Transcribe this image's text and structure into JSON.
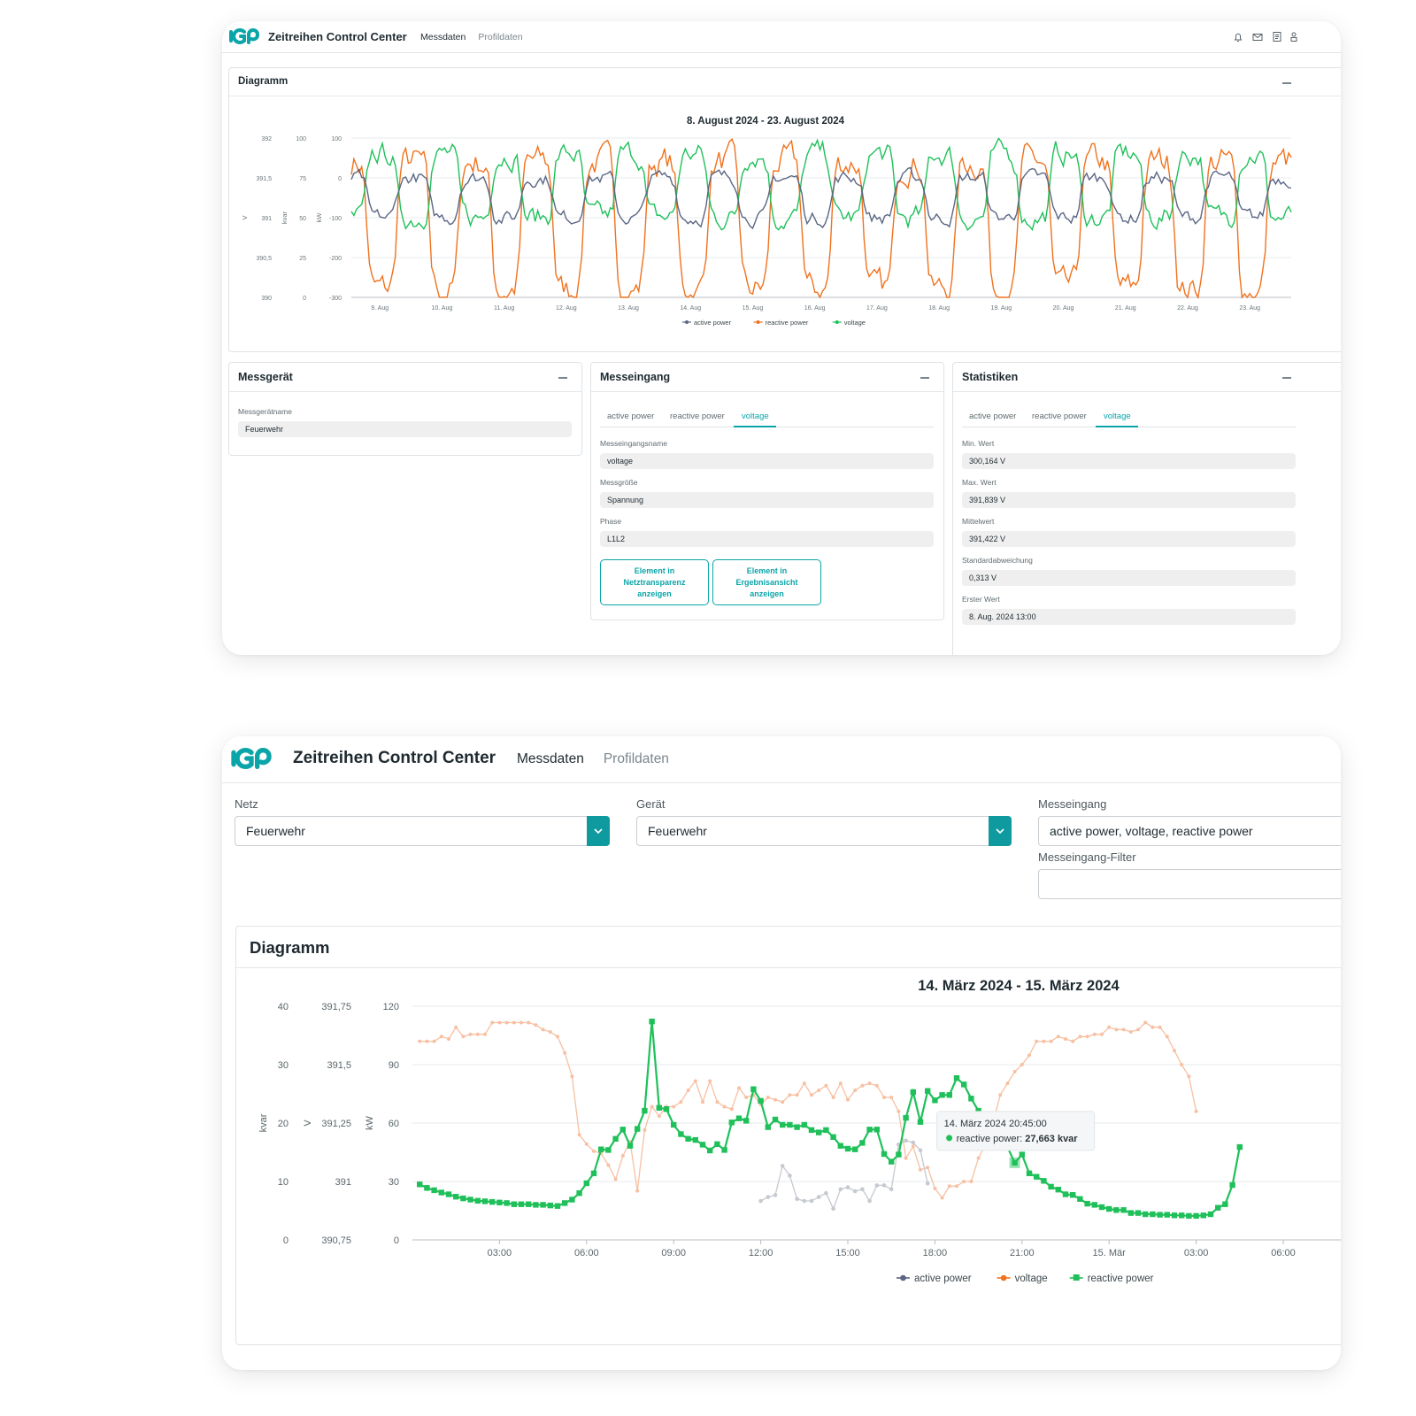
{
  "colors": {
    "accent": "#0aa5a8",
    "active_power": "#5b6684",
    "reactive_power": "#f0721e",
    "voltage": "#1fc05a",
    "reactive_power_2": "#1fc05a",
    "voltage_faded": "#f7c0a3",
    "active_faded": "#c5c9d0"
  },
  "top_window": {
    "app_title": "Zeitreihen Control Center",
    "nav": [
      "Messdaten",
      "Profildaten"
    ],
    "header_icons": [
      "bell-icon",
      "mail-icon",
      "document-icon",
      "users-icon"
    ],
    "diagram_panel": {
      "title": "Diagramm"
    },
    "device_panel": {
      "title": "Messgerät",
      "fields": [
        {
          "label": "Messgerätname",
          "value": "Feuerwehr"
        }
      ]
    },
    "input_panel": {
      "title": "Messeingang",
      "tabs": [
        "active power",
        "reactive power",
        "voltage"
      ],
      "active_tab": "voltage",
      "fields": [
        {
          "label": "Messeingangsname",
          "value": "voltage"
        },
        {
          "label": "Messgröße",
          "value": "Spannung"
        },
        {
          "label": "Phase",
          "value": "L1L2"
        }
      ],
      "buttons": [
        [
          "Element in",
          "Netztransparenz",
          "anzeigen"
        ],
        [
          "Element in",
          "Ergebnisansicht",
          "anzeigen"
        ]
      ]
    },
    "stats_panel": {
      "title": "Statistiken",
      "tabs": [
        "active power",
        "reactive power",
        "voltage"
      ],
      "active_tab": "voltage",
      "fields": [
        {
          "label": "Min. Wert",
          "value": "300,164 V"
        },
        {
          "label": "Max. Wert",
          "value": "391,839 V"
        },
        {
          "label": "Mittelwert",
          "value": "391,422 V"
        },
        {
          "label": "Standardabweichung",
          "value": "0,313 V"
        },
        {
          "label": "Erster Wert",
          "value": "8. Aug. 2024 13:00"
        }
      ]
    }
  },
  "bottom_window": {
    "app_title": "Zeitreihen Control Center",
    "nav": [
      "Messdaten",
      "Profildaten"
    ],
    "filters": {
      "netz_label": "Netz",
      "netz_value": "Feuerwehr",
      "geraet_label": "Gerät",
      "geraet_value": "Feuerwehr",
      "messeingang_label": "Messeingang",
      "messeingang_value": "active power, voltage, reactive power",
      "filter_label": "Messeingang-Filter",
      "filter_value": ""
    },
    "diagram_panel": {
      "title": "Diagramm"
    }
  },
  "chart_data": [
    {
      "type": "line",
      "title": "8. August 2024 - 23. August 2024",
      "x_ticks": [
        "9. Aug",
        "10. Aug",
        "11. Aug",
        "12. Aug",
        "13. Aug",
        "14. Aug",
        "15. Aug",
        "16. Aug",
        "17. Aug",
        "18. Aug",
        "19. Aug",
        "20. Aug",
        "21. Aug",
        "22. Aug",
        "23. Aug"
      ],
      "axes": [
        {
          "label": "V",
          "ticks": [
            "392",
            "391,5",
            "391",
            "390,5",
            "390"
          ],
          "ylim": [
            390,
            392
          ]
        },
        {
          "label": "kvar",
          "ticks": [
            "100",
            "75",
            "50",
            "25",
            "0"
          ],
          "ylim": [
            0,
            100
          ]
        },
        {
          "label": "kW",
          "ticks": [
            "100",
            "0",
            "-100",
            "-200",
            "-300"
          ],
          "ylim": [
            -300,
            100
          ]
        }
      ],
      "series_daily_profile": {
        "active power": {
          "unit": "kW",
          "day": 0,
          "night": -100,
          "noise": 15
        },
        "reactive power": {
          "unit": "kvar",
          "day": 85,
          "night": 5,
          "noise": 8
        },
        "voltage": {
          "unit": "V",
          "day": 391.0,
          "night": 391.8,
          "noise": 0.12
        }
      },
      "legend": [
        "active power",
        "reactive power",
        "voltage"
      ]
    },
    {
      "type": "line",
      "title": "14. März 2024 - 15. März 2024",
      "x_ticks": [
        "03:00",
        "06:00",
        "09:00",
        "12:00",
        "15:00",
        "18:00",
        "21:00",
        "15. Mär",
        "03:00",
        "06:00"
      ],
      "axes": [
        {
          "label": "kvar",
          "ticks": [
            "40",
            "30",
            "20",
            "10",
            "0"
          ],
          "ylim": [
            0,
            40
          ]
        },
        {
          "label": "V",
          "ticks": [
            "391,75",
            "391,5",
            "391,25",
            "391",
            "390,75"
          ],
          "ylim": [
            390.75,
            391.75
          ]
        },
        {
          "label": "kW",
          "ticks": [
            "120",
            "90",
            "60",
            "30",
            "0"
          ],
          "ylim": [
            0,
            120
          ]
        }
      ],
      "x_start_hour": 0.25,
      "x_step_hours": 0.25,
      "series": [
        {
          "name": "reactive power",
          "unit": "kvar",
          "values": [
            9.5,
            8.9,
            8.5,
            8.1,
            7.8,
            7.4,
            7.1,
            6.9,
            6.7,
            6.6,
            6.5,
            6.4,
            6.3,
            6.1,
            6.1,
            6.1,
            6.0,
            6.0,
            5.9,
            5.8,
            6.3,
            6.9,
            8.0,
            9.7,
            11.4,
            15.5,
            15.4,
            17.3,
            18.9,
            16.1,
            19.0,
            22.1,
            37.4,
            22.6,
            22.4,
            19.7,
            18.1,
            17.3,
            17.1,
            16.3,
            15.3,
            16.4,
            15.4,
            20.1,
            20.8,
            20.4,
            25.8,
            23.8,
            19.3,
            20.6,
            19.7,
            19.7,
            19.3,
            19.7,
            18.8,
            18.4,
            18.8,
            17.6,
            16.1,
            15.6,
            15.5,
            16.6,
            18.9,
            18.9,
            14.7,
            13.4,
            14.6,
            20.9,
            25.3,
            20.2,
            25.5,
            23.9,
            24.8,
            24.8,
            27.7,
            26.6,
            24.2,
            22.1,
            18.9,
            17.4,
            16.2,
            15.9,
            13.2,
            14.6,
            11.4,
            10.8,
            10.1,
            9.1,
            8.6,
            7.8,
            7.7,
            7.0,
            6.2,
            6.0,
            5.6,
            5.3,
            5.1,
            5.1,
            4.6,
            4.6,
            4.4,
            4.4,
            4.3,
            4.3,
            4.2,
            4.2,
            4.1,
            4.1,
            4.2,
            4.4,
            5.5,
            6.1,
            9.4,
            15.9
          ]
        },
        {
          "name": "voltage",
          "unit": "V",
          "values": [
            391.6,
            391.6,
            391.6,
            391.62,
            391.61,
            391.66,
            391.62,
            391.63,
            391.63,
            391.63,
            391.68,
            391.68,
            391.68,
            391.68,
            391.68,
            391.68,
            391.67,
            391.65,
            391.64,
            391.62,
            391.55,
            391.45,
            391.2,
            391.16,
            391.13,
            391.12,
            391.07,
            391.01,
            391.11,
            391.17,
            390.96,
            391.22,
            391.32,
            391.28,
            391.32,
            391.32,
            391.34,
            391.39,
            391.43,
            391.34,
            391.43,
            391.34,
            391.32,
            391.31,
            391.4,
            391.36,
            391.37,
            391.33,
            391.36,
            391.35,
            391.34,
            391.37,
            391.37,
            391.42,
            391.37,
            391.39,
            391.41,
            391.36,
            391.42,
            391.35,
            391.39,
            391.41,
            391.42,
            391.41,
            391.36,
            391.36,
            391.3,
            391.1,
            391.15,
            391.05,
            391.06,
            390.97,
            390.93,
            390.98,
            390.98,
            391.0,
            391.0,
            391.1,
            391.16,
            391.25,
            391.37,
            391.42,
            391.47,
            391.5,
            391.54,
            391.6,
            391.6,
            391.6,
            391.62,
            391.61,
            391.6,
            391.62,
            391.62,
            391.63,
            391.63,
            391.66,
            391.65,
            391.65,
            391.64,
            391.65,
            391.68,
            391.66,
            391.66,
            391.62,
            391.56,
            391.5,
            391.45,
            391.3
          ]
        },
        {
          "name": "active power",
          "unit": "kW",
          "values": [
            20,
            22,
            23,
            38,
            33,
            21,
            20,
            20,
            22,
            24,
            16,
            26,
            27,
            25,
            26,
            20,
            28,
            28,
            26,
            49,
            51,
            50,
            46,
            29
          ]
        }
      ],
      "active_power_x_start_hour": 12.0,
      "legend": [
        "active power",
        "voltage",
        "reactive power"
      ],
      "tooltip": {
        "title": "14. März 2024 20:45:00",
        "series": "reactive power",
        "value": "27,663 kvar"
      }
    }
  ]
}
